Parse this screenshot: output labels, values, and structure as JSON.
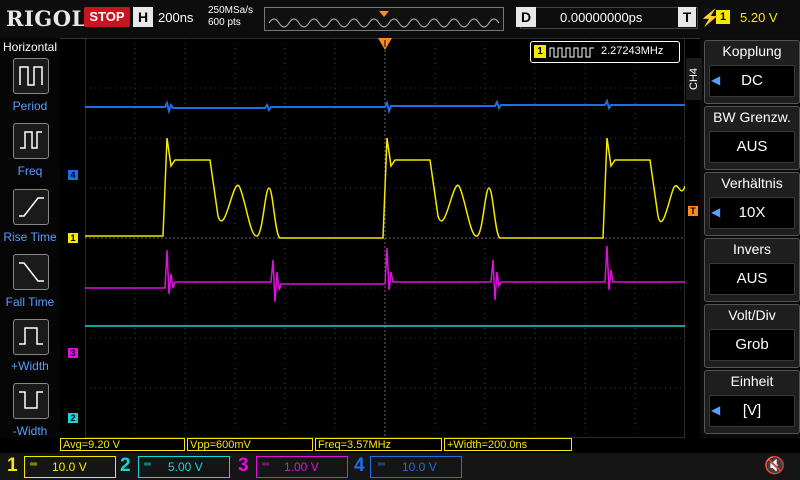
{
  "top": {
    "brand": "RIGOL",
    "run_state": "STOP",
    "horizontal_label": "H",
    "timebase": "200ns",
    "sample_rate": "250MSa/s",
    "memory_depth": "600 pts",
    "delay_label": "D",
    "delay_value": "0.00000000ps",
    "trigger_label": "T",
    "trigger_source": "1",
    "trigger_level": "5.20 V"
  },
  "left_menu": {
    "title": "Horizontal",
    "items": [
      "Period",
      "Freq",
      "Rise Time",
      "Fall Time",
      "+Width",
      "-Width"
    ]
  },
  "right_menu": {
    "channel_tab": "CH4",
    "items": [
      {
        "title": "Kopplung",
        "value": "DC"
      },
      {
        "title": "BW Grenzw.",
        "value": "AUS"
      },
      {
        "title": "Verhältnis",
        "value": "10X"
      },
      {
        "title": "Invers",
        "value": "AUS"
      },
      {
        "title": "Volt/Div",
        "value": "Grob"
      },
      {
        "title": "Einheit",
        "value": "[V]"
      }
    ]
  },
  "frequency_counter": {
    "channel": "1",
    "value": "2.27243MHz"
  },
  "measurements": [
    "Avg=9.20 V",
    "Vpp=600mV",
    "Freq=3.57MHz",
    "+Width=200.0ns"
  ],
  "channels": [
    {
      "num": "1",
      "scale": "10.0 V",
      "color": "#f6e800"
    },
    {
      "num": "2",
      "scale": "5.00 V",
      "color": "#19d5d5"
    },
    {
      "num": "3",
      "scale": "1.00 V",
      "color": "#e010e0"
    },
    {
      "num": "4",
      "scale": "10.0 V",
      "color": "#1e6ee6"
    }
  ],
  "markers": {
    "ch1": "1",
    "ch2": "2",
    "ch3": "3",
    "ch4": "4",
    "trigger": "T"
  }
}
